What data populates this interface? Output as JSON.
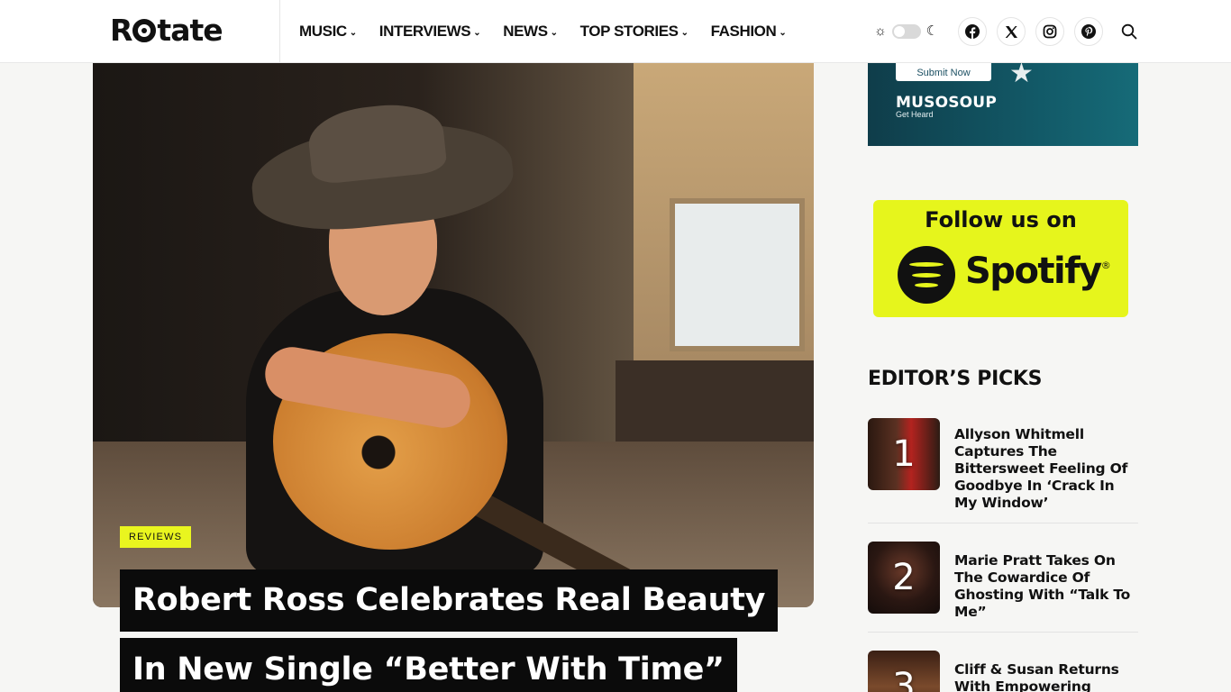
{
  "header": {
    "logo": {
      "prefix": "R",
      "suffix": "tate"
    },
    "nav": [
      {
        "label": "MUSIC"
      },
      {
        "label": "INTERVIEWS"
      },
      {
        "label": "NEWS"
      },
      {
        "label": "TOP STORIES"
      },
      {
        "label": "FASHION"
      }
    ],
    "theme_toggle": {
      "mode": "light"
    },
    "social": [
      "facebook-icon",
      "x-icon",
      "instagram-icon",
      "pinterest-icon"
    ]
  },
  "article": {
    "category": "REVIEWS",
    "title_line1": "Robert Ross Celebrates Real Beauty",
    "title_line2": "In New Single “Better With Time”"
  },
  "sidebar": {
    "muso_ad": {
      "button": "Submit Now",
      "brand": "MUSOSOUP",
      "tagline": "Get Heard"
    },
    "spotify_ad": {
      "line1": "Follow us on",
      "brand": "Spotify",
      "mark": "®"
    },
    "editors_picks": {
      "heading": "EDITOR’S PICKS",
      "items": [
        {
          "rank": "1",
          "title": "Allyson Whitmell Captures The Bittersweet Feeling Of Goodbye In ‘Crack In My Window’"
        },
        {
          "rank": "2",
          "title": "Marie Pratt Takes On The Cowardice Of Ghosting With “Talk To Me”"
        },
        {
          "rank": "3",
          "title": "Cliff & Susan Returns With Empowering"
        }
      ]
    }
  },
  "colors": {
    "accent": "#e9f51f",
    "dark": "#0b0b0b",
    "muso_bg": "#125866",
    "spotify_bg": "#e6f51c"
  }
}
